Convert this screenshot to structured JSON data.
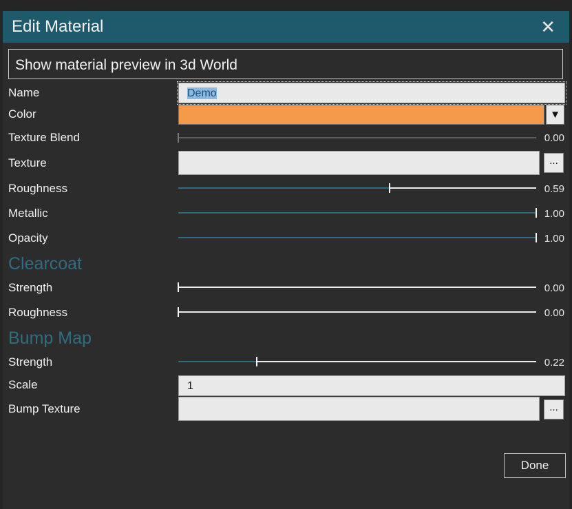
{
  "dialog": {
    "title": "Edit Material",
    "close_icon": "close-icon"
  },
  "preview_button": {
    "label": "Show material preview in 3d World"
  },
  "fields": {
    "name": {
      "label": "Name",
      "value": "Demo"
    },
    "color": {
      "label": "Color",
      "value": "#f59a4a"
    },
    "texture_blend": {
      "label": "Texture Blend",
      "value": 0.0,
      "display": "0.00"
    },
    "texture": {
      "label": "Texture",
      "value": "",
      "browse_label": "..."
    },
    "roughness": {
      "label": "Roughness",
      "value": 0.59,
      "display": "0.59"
    },
    "metallic": {
      "label": "Metallic",
      "value": 1.0,
      "display": "1.00"
    },
    "opacity": {
      "label": "Opacity",
      "value": 1.0,
      "display": "1.00"
    }
  },
  "clearcoat": {
    "heading": "Clearcoat",
    "strength": {
      "label": "Strength",
      "value": 0.0,
      "display": "0.00"
    },
    "roughness": {
      "label": "Roughness",
      "value": 0.0,
      "display": "0.00"
    }
  },
  "bump_map": {
    "heading": "Bump Map",
    "strength": {
      "label": "Strength",
      "value": 0.22,
      "display": "0.22"
    },
    "scale": {
      "label": "Scale",
      "value": "1"
    },
    "texture": {
      "label": "Bump Texture",
      "value": "",
      "browse_label": "..."
    }
  },
  "done_button": {
    "label": "Done"
  },
  "colors": {
    "accent": "#2c6b80",
    "titlebar": "#1f5a6c",
    "swatch": "#f59a4a"
  }
}
